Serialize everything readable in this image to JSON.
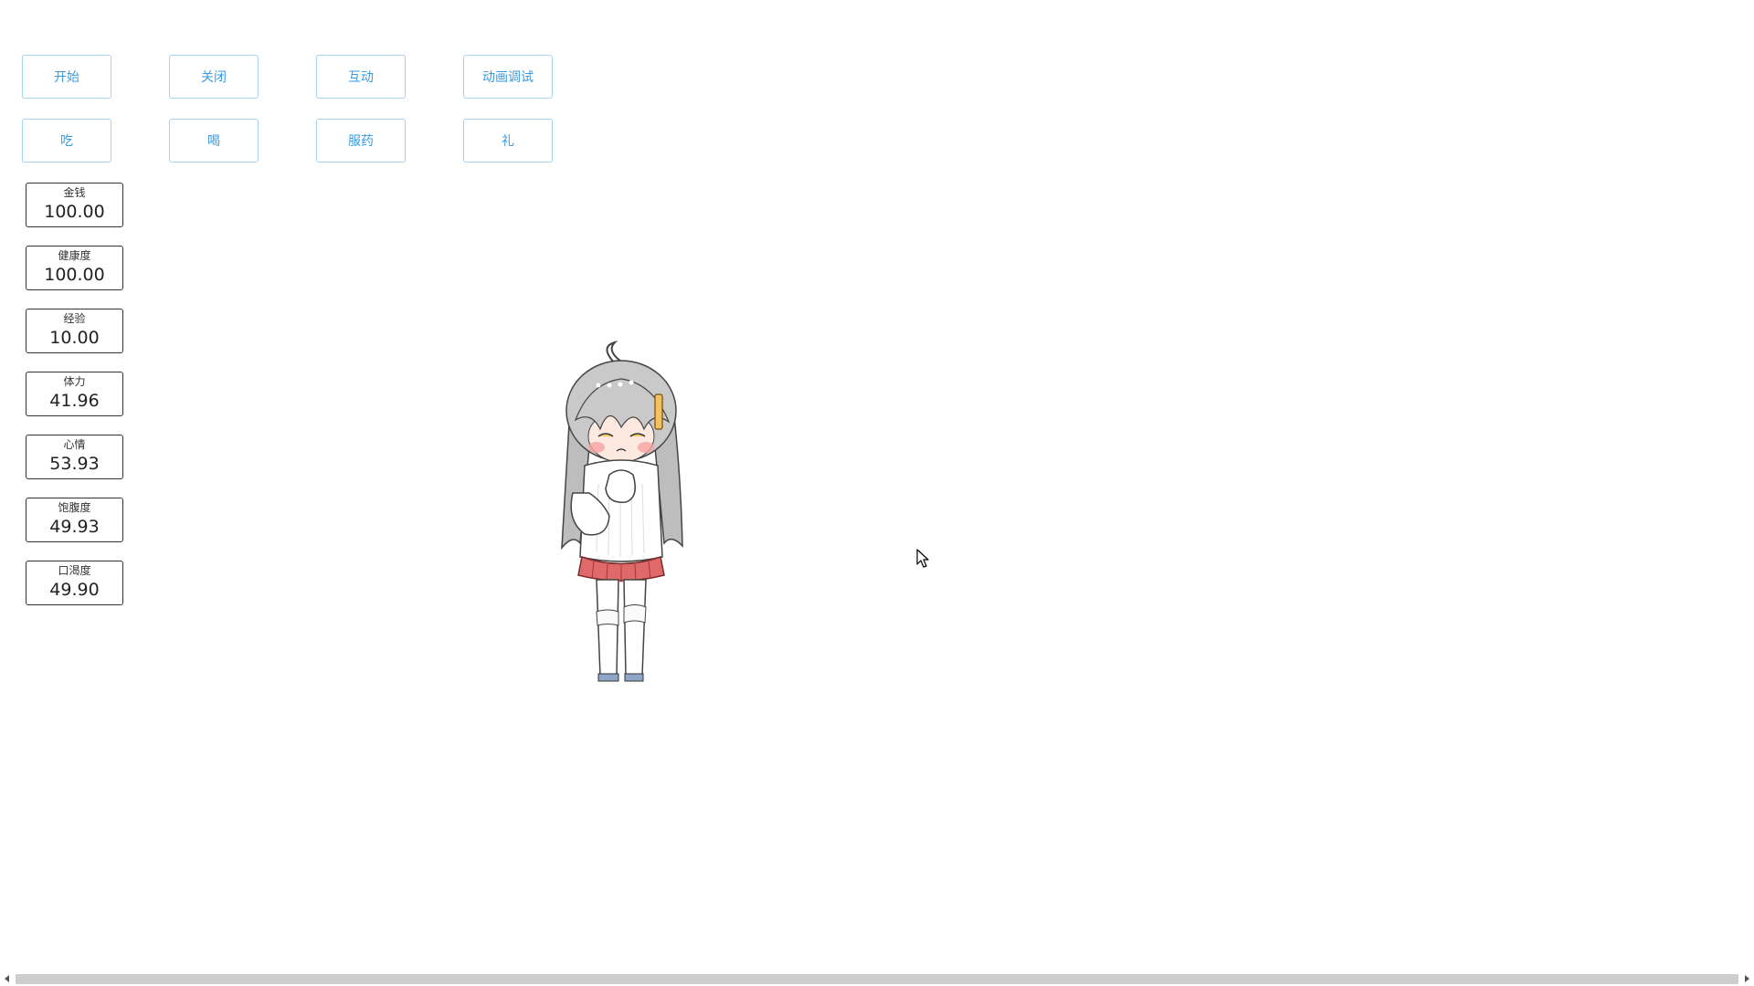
{
  "buttons": {
    "start": "开始",
    "close": "关闭",
    "interact": "互动",
    "anim_debug": "动画调试",
    "eat": "吃",
    "drink": "喝",
    "medicine": "服药",
    "gift": "礼"
  },
  "stats": {
    "money": {
      "label": "金钱",
      "value": "100.00"
    },
    "health": {
      "label": "健康度",
      "value": "100.00"
    },
    "exp": {
      "label": "经验",
      "value": "10.00"
    },
    "stamina": {
      "label": "体力",
      "value": "41.96"
    },
    "mood": {
      "label": "心情",
      "value": "53.93"
    },
    "satiety": {
      "label": "饱腹度",
      "value": "49.93"
    },
    "thirst": {
      "label": "口渴度",
      "value": "49.90"
    }
  },
  "colors": {
    "button_border": "#a7d3f2",
    "button_text": "#3a9be0",
    "stat_border": "#333333"
  },
  "icons": {
    "character": "anime-girl-pet",
    "cursor": "mouse-pointer-icon"
  }
}
